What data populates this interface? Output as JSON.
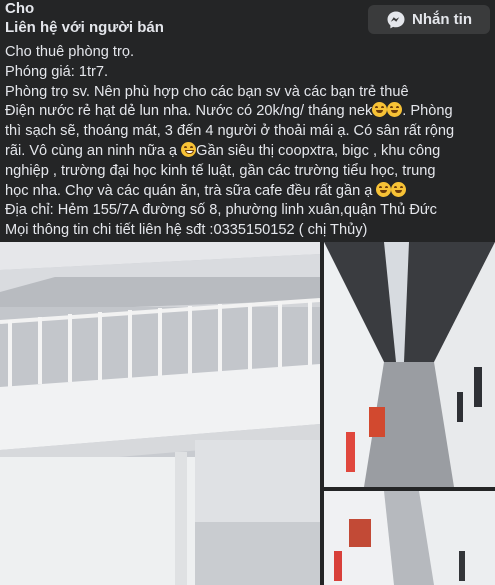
{
  "header": {
    "seller": "Cho",
    "contact_title": "Liên hệ với người bán",
    "message_button": "Nhắn tin"
  },
  "post": {
    "lines": [
      "Cho thuê phòng trọ.",
      "Phóng giá: 1tr7.",
      "Phòng trọ sv. Nên phù hợp cho các bạn sv và các bạn trẻ thuê",
      "Điện nước rẻ hạt dẻ lun nha. Nước có 20k/ng/ tháng nek",
      ". Phòng",
      "thì sạch sẽ, thoáng mát, 3 đến 4 người ở thoải mái ạ. Có sân rất rộng",
      "rãi. Vô cùng an ninh nữa ạ ",
      "Gần siêu thị coopxtra, bigc , khu công",
      "nghiệp , trường đại học kinh tế luật, gần các trường tiểu học, trung",
      "học nha. Chợ và các quán ăn, trà sữa cafe đều rất gần ạ ",
      "Địa chỉ: Hẻm 155/7A đường số 8, phường linh xuân,quận Thủ Đức",
      "Mọi thông tin chi tiết liên hệ sđt :0335150152 ( chị Thủy)"
    ]
  },
  "gallery": {
    "photos": [
      "loft-room",
      "corridor-upper",
      "corridor-lower"
    ]
  },
  "icons": {
    "messenger": "messenger-icon",
    "emoji": "smiling-face-emoji"
  },
  "colors": {
    "background": "#242526",
    "text": "#e4e6eb",
    "button": "#3a3b3c"
  }
}
